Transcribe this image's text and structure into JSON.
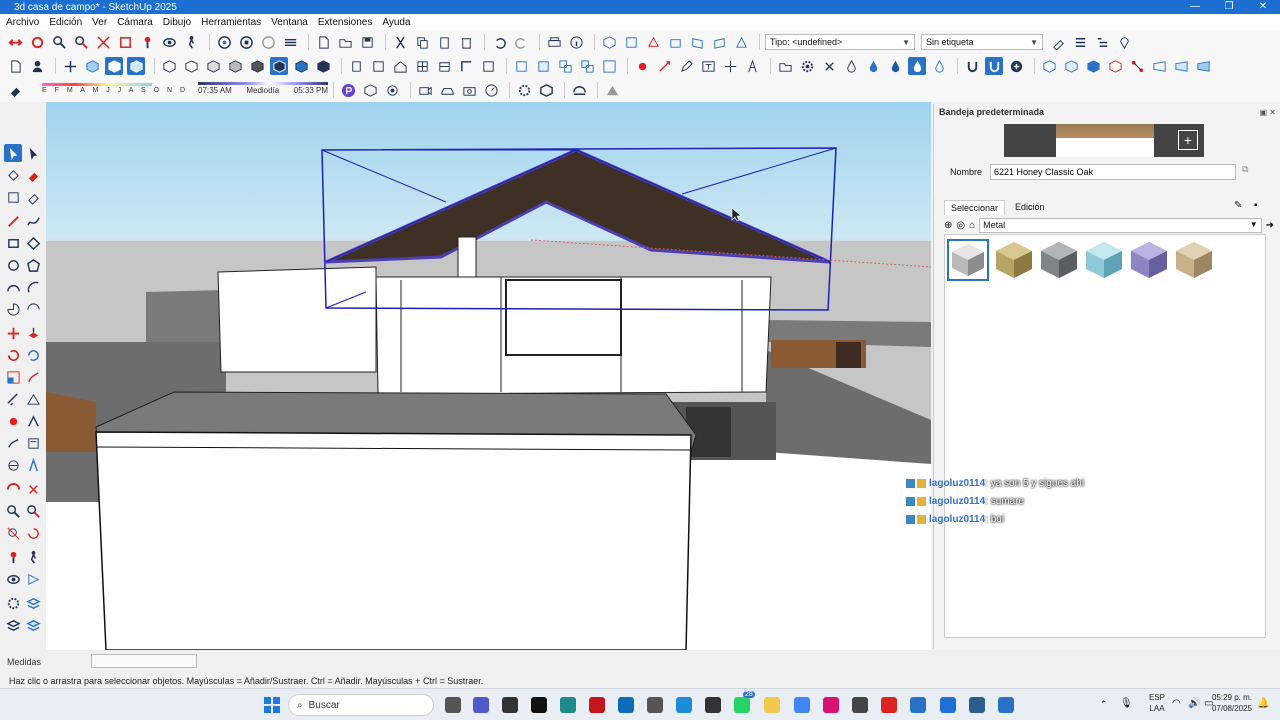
{
  "window": {
    "title": "3d casa de campo* - SketchUp 2025"
  },
  "menu": [
    "Archivo",
    "Edición",
    "Ver",
    "Cámara",
    "Dibujo",
    "Herramientas",
    "Ventana",
    "Extensiones",
    "Ayuda"
  ],
  "toolbar": {
    "type_combo": "Tipo: <undefined>",
    "tag_combo": "Sin etiqueta"
  },
  "shadows": {
    "months": "E F M A M J J A S O N D",
    "time_start": "07:35 AM",
    "time_mid": "Mediodía",
    "time_end": "05:33 PM"
  },
  "panel": {
    "title": "Bandeja predeterminada",
    "name_label": "Nombre",
    "name_value": "6221 Honey Classic Oak",
    "tab_select": "Seleccionar",
    "tab_edit": "Edición",
    "category": "Metal",
    "swatch_colors": [
      "#b9b9b9",
      "#b8a465",
      "#7f8486",
      "#8ec9d9",
      "#8c86c4",
      "#c7b08a"
    ]
  },
  "chat": [
    {
      "user": "lagoluz0114",
      "message": ": ya son 5 y sigues ahi"
    },
    {
      "user": "lagoluz0114",
      "message": ": sumare"
    },
    {
      "user": "lagoluz0114",
      "message": ": boi"
    }
  ],
  "measures": {
    "label": "Medidas"
  },
  "status": {
    "hint": "Haz clic o arrastra para seleccionar objetos. Mayúsculas = Añadir/Sustraer. Ctrl = Añadir. Mayúsculas + Ctrl = Sustraer."
  },
  "taskbar": {
    "search": "Buscar",
    "badge": "28",
    "lang": "ESP",
    "lang2": "LAA",
    "time": "05:29 p. m.",
    "date": "07/08/2025"
  }
}
